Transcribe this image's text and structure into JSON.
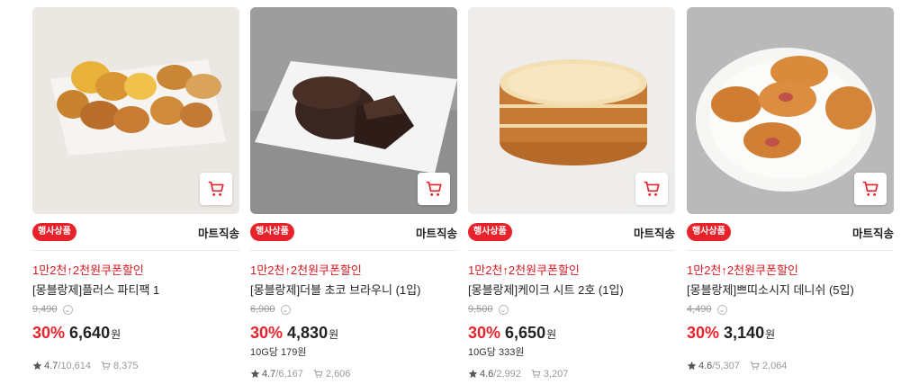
{
  "products": [
    {
      "event_badge": "행사상품",
      "delivery": "마트직송",
      "promo": "1만2천↑2천원쿠폰할인",
      "name": "[몽블랑제]플러스 파티팩 1",
      "original_price": "9,490",
      "discount_rate": "30%",
      "price": "6,640",
      "currency": "원",
      "unit_price": "",
      "rating": "4.7",
      "review_count": "/10,614",
      "cart_count": "8,375",
      "image_icon": "pastry-assortment-image"
    },
    {
      "event_badge": "행사상품",
      "delivery": "마트직송",
      "promo": "1만2천↑2천원쿠폰할인",
      "name": "[몽블랑제]더블 초코 브라우니 (1입)",
      "original_price": "6,900",
      "discount_rate": "30%",
      "price": "4,830",
      "currency": "원",
      "unit_price": "10G당 179원",
      "rating": "4.7",
      "review_count": "/6,167",
      "cart_count": "2,606",
      "image_icon": "chocolate-brownie-image"
    },
    {
      "event_badge": "행사상품",
      "delivery": "마트직송",
      "promo": "1만2천↑2천원쿠폰할인",
      "name": "[몽블랑제]케이크 시트 2호 (1입)",
      "original_price": "9,500",
      "discount_rate": "30%",
      "price": "6,650",
      "currency": "원",
      "unit_price": "10G당 333원",
      "rating": "4.6",
      "review_count": "/2,992",
      "cart_count": "3,207",
      "image_icon": "sponge-cake-sheet-image"
    },
    {
      "event_badge": "행사상품",
      "delivery": "마트직송",
      "promo": "1만2천↑2천원쿠폰할인",
      "name": "[몽블랑제]쁘띠소시지 데니쉬 (5입)",
      "original_price": "4,490",
      "discount_rate": "30%",
      "price": "3,140",
      "currency": "원",
      "unit_price": "",
      "rating": "4.6",
      "review_count": "/5,307",
      "cart_count": "2,064",
      "image_icon": "sausage-danish-image"
    }
  ],
  "colors": {
    "accent_red": "#e8222b",
    "promo_red": "#d71920"
  }
}
